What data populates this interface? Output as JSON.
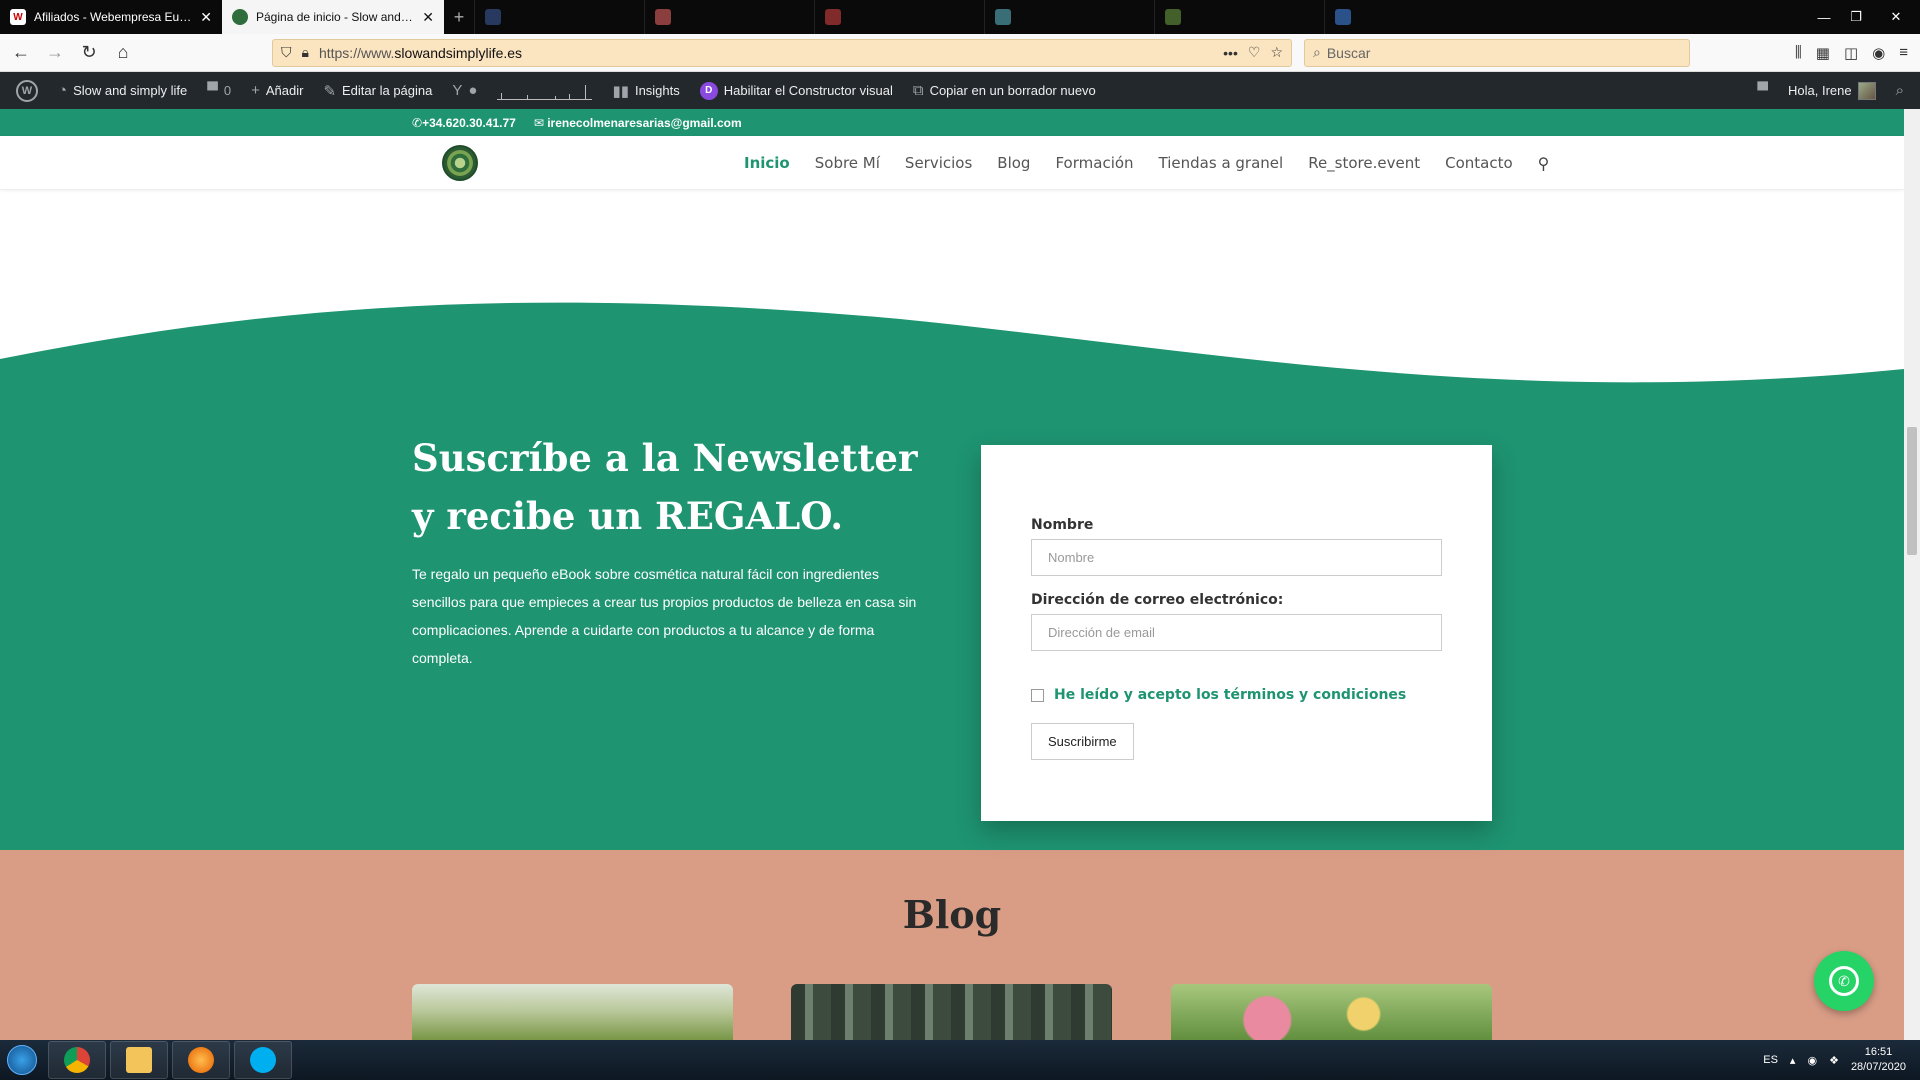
{
  "browser": {
    "tabs": [
      {
        "title": "Afiliados - Webempresa Europa",
        "active": false
      },
      {
        "title": "Página de inicio - Slow and simply life",
        "active": true
      }
    ],
    "url_prefix": "https://www.",
    "url_domain": "slowandsimplylife.es",
    "search_placeholder": "Buscar"
  },
  "wpbar": {
    "site_name": "Slow and simply life",
    "comments_count": "0",
    "add_label": "Añadir",
    "edit_label": "Editar la página",
    "insights_label": "Insights",
    "visual_builder_label": "Habilitar el Constructor visual",
    "copy_draft_label": "Copiar en un borrador nuevo",
    "greeting": "Hola, Irene"
  },
  "site": {
    "phone": "+34.620.30.41.77",
    "email": "irenecolmenaresarias@gmail.com",
    "menu": [
      "Inicio",
      "Sobre Mí",
      "Servicios",
      "Blog",
      "Formación",
      "Tiendas a granel",
      "Re_store.event",
      "Contacto"
    ],
    "newsletter": {
      "title": "Suscríbe a la Newsletter y recibe un REGALO.",
      "text": "Te regalo un pequeño eBook sobre cosmética natural fácil con ingredientes sencillos para que empieces a crear tus propios productos de belleza en casa sin complicaciones. Aprende a cuidarte con productos a tu alcance y de forma completa."
    },
    "form": {
      "name_label": "Nombre",
      "name_placeholder": "Nombre",
      "email_label": "Dirección de correo electrónico:",
      "email_placeholder": "Dirección de email",
      "terms_label": "He leído y acepto los términos y condiciones",
      "submit_label": "Suscribirme"
    },
    "blog_title": "Blog"
  },
  "taskbar": {
    "lang": "ES",
    "time": "16:51",
    "date": "28/07/2020"
  },
  "colors": {
    "brand_green": "#1e9471",
    "blog_bg": "#d99d86",
    "whatsapp": "#25d366"
  }
}
